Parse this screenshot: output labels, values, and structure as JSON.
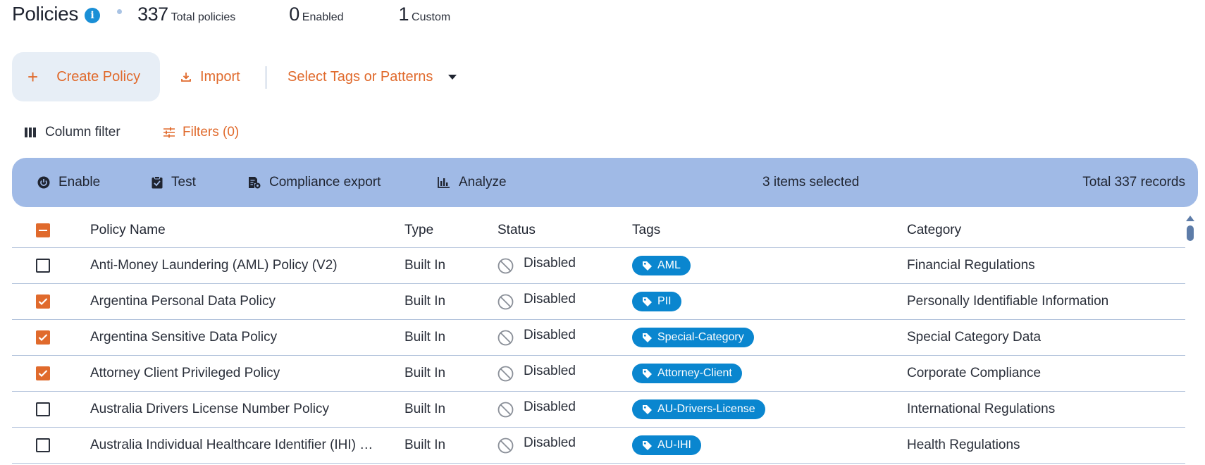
{
  "header": {
    "title": "Policies",
    "total_count": "337",
    "total_label": "Total policies",
    "enabled_count": "0",
    "enabled_label": "Enabled",
    "custom_count": "1",
    "custom_label": "Custom"
  },
  "actions": {
    "create_label": "Create Policy",
    "import_label": "Import",
    "tag_select_placeholder": "Select Tags or Patterns"
  },
  "filters": {
    "column_filter_label": "Column filter",
    "filters_label": "Filters (0)"
  },
  "bulk_bar": {
    "enable_label": "Enable",
    "test_label": "Test",
    "compliance_label": "Compliance export",
    "analyze_label": "Analyze",
    "selected_text": "3 items selected",
    "total_text": "Total 337 records"
  },
  "table": {
    "columns": {
      "name": "Policy Name",
      "type": "Type",
      "status": "Status",
      "tags": "Tags",
      "category": "Category"
    },
    "rows": [
      {
        "name": "Anti-Money Laundering (AML) Policy (V2)",
        "type": "Built In",
        "status": "Disabled",
        "tag": "AML",
        "category": "Financial Regulations",
        "checked": false
      },
      {
        "name": "Argentina Personal Data Policy",
        "type": "Built In",
        "status": "Disabled",
        "tag": "PII",
        "category": "Personally Identifiable Information",
        "checked": true
      },
      {
        "name": "Argentina Sensitive Data Policy",
        "type": "Built In",
        "status": "Disabled",
        "tag": "Special-Category",
        "category": "Special Category Data",
        "checked": true
      },
      {
        "name": "Attorney Client Privileged Policy",
        "type": "Built In",
        "status": "Disabled",
        "tag": "Attorney-Client",
        "category": "Corporate Compliance",
        "checked": true
      },
      {
        "name": "Australia Drivers License Number Policy",
        "type": "Built In",
        "status": "Disabled",
        "tag": "AU-Drivers-License",
        "category": "International Regulations",
        "checked": false
      },
      {
        "name": "Australia Individual Healthcare Identifier (IHI) Policy",
        "type": "Built In",
        "status": "Disabled",
        "tag": "AU-IHI",
        "category": "Health Regulations",
        "checked": false
      }
    ]
  },
  "icons": {
    "info": "info-icon",
    "plus": "plus-icon",
    "import": "download-icon",
    "caret": "caret-down-icon",
    "column_filter": "columns-icon",
    "filters": "sliders-icon",
    "enable": "power-icon",
    "test": "clipboard-check-icon",
    "compliance": "file-export-icon",
    "analyze": "bar-chart-icon",
    "status_disabled": "ban-icon",
    "tag": "tag-icon"
  },
  "colors": {
    "accent_orange": "#e06a2c",
    "bulk_bar_bg": "#a0bae6",
    "tag_blue": "#0a86cf",
    "info_blue": "#1a8fd6",
    "create_bg": "#e7eef6"
  }
}
